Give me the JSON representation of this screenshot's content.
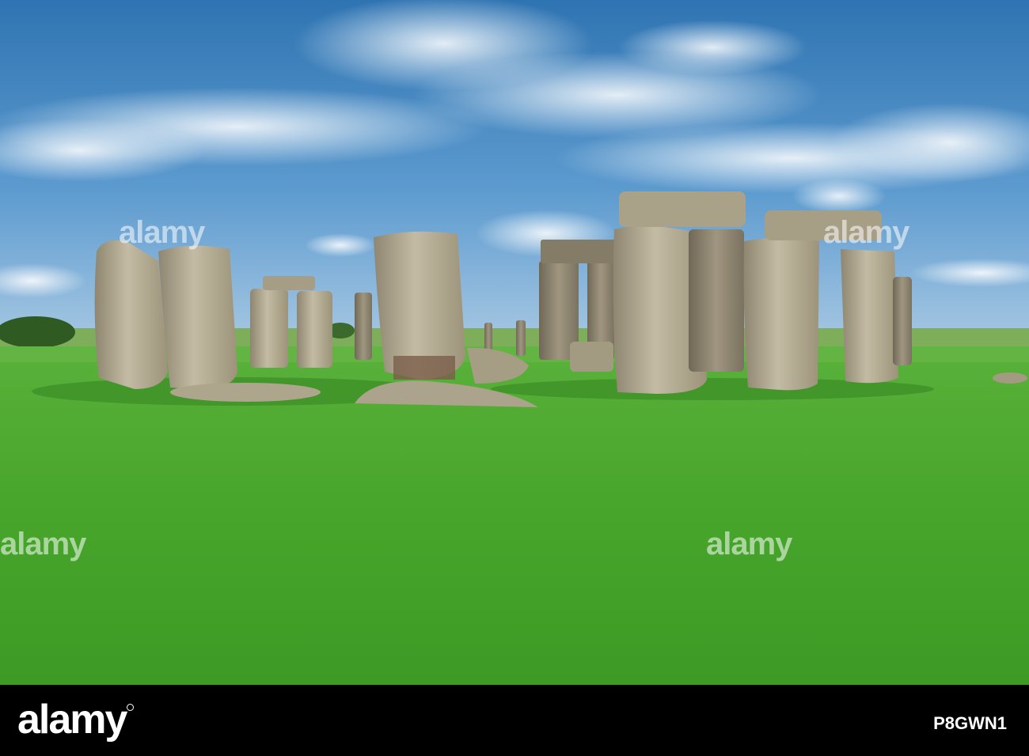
{
  "photo": {
    "subject": "stone-circle-landscape",
    "sky_color": "#3f86c0",
    "grass_color": "#4caf2e",
    "stone_color": "#b8ae95"
  },
  "watermark": {
    "text": "alamy"
  },
  "footer": {
    "logo_text": "alamy",
    "image_code": "P8GWN1"
  }
}
